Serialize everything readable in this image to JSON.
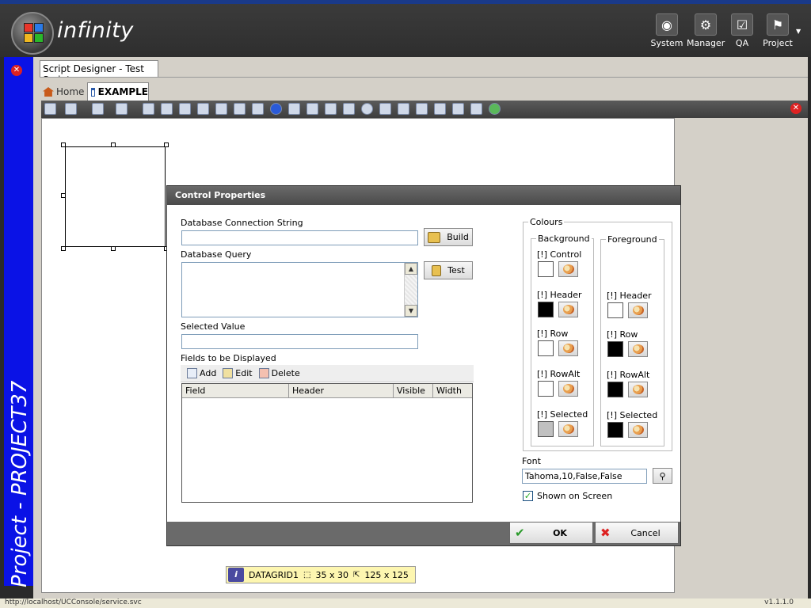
{
  "app": {
    "name": "infinity"
  },
  "header": {
    "buttons": [
      {
        "label": "System",
        "icon": "globe-icon"
      },
      {
        "label": "Manager",
        "icon": "gear-icon"
      },
      {
        "label": "QA",
        "icon": "checkbox-icon"
      },
      {
        "label": "Project",
        "icon": "flag-icon"
      }
    ]
  },
  "sidebar": {
    "project_label": "Project - PROJECT37"
  },
  "document_tab": "Script Designer - Test Script",
  "tabs": {
    "home": "Home",
    "example": "EXAMPLE"
  },
  "selection_info": {
    "name": "DATAGRID1",
    "position": "35 x 30",
    "size": "125 x 125"
  },
  "dialog": {
    "title": "Control Properties",
    "connection_label": "Database Connection String",
    "connection_value": "",
    "build_button": "Build",
    "query_label": "Database Query",
    "query_value": "",
    "test_button": "Test",
    "selected_value_label": "Selected Value",
    "selected_value": "",
    "fields_label": "Fields to be Displayed",
    "fields_toolbar": {
      "add": "Add",
      "edit": "Edit",
      "delete": "Delete"
    },
    "grid_columns": [
      "Field",
      "Header",
      "Visible",
      "Width"
    ],
    "colours": {
      "title": "Colours",
      "background_title": "Background",
      "foreground_title": "Foreground",
      "background": [
        {
          "label": "[!] Control",
          "color": "#ffffff"
        },
        {
          "label": "[!] Header",
          "color": "#000000"
        },
        {
          "label": "[!] Row",
          "color": "#ffffff"
        },
        {
          "label": "[!] RowAlt",
          "color": "#ffffff"
        },
        {
          "label": "[!] Selected",
          "color": "#c0c0c0"
        }
      ],
      "foreground": [
        {
          "label": "[!] Header",
          "color": "#ffffff"
        },
        {
          "label": "[!] Row",
          "color": "#000000"
        },
        {
          "label": "[!] RowAlt",
          "color": "#000000"
        },
        {
          "label": "[!] Selected",
          "color": "#000000"
        }
      ]
    },
    "font_label": "Font",
    "font_value": "Tahoma,10,False,False",
    "shown_on_screen_label": "Shown on Screen",
    "shown_on_screen": true,
    "ok_button": "OK",
    "cancel_button": "Cancel"
  },
  "status": {
    "url": "http://localhost/UCConsole/service.svc",
    "version": "v1.1.1.0"
  },
  "colors": {
    "sidebar": "#0a12e6",
    "header": "#333333",
    "close": "#dd2222"
  }
}
